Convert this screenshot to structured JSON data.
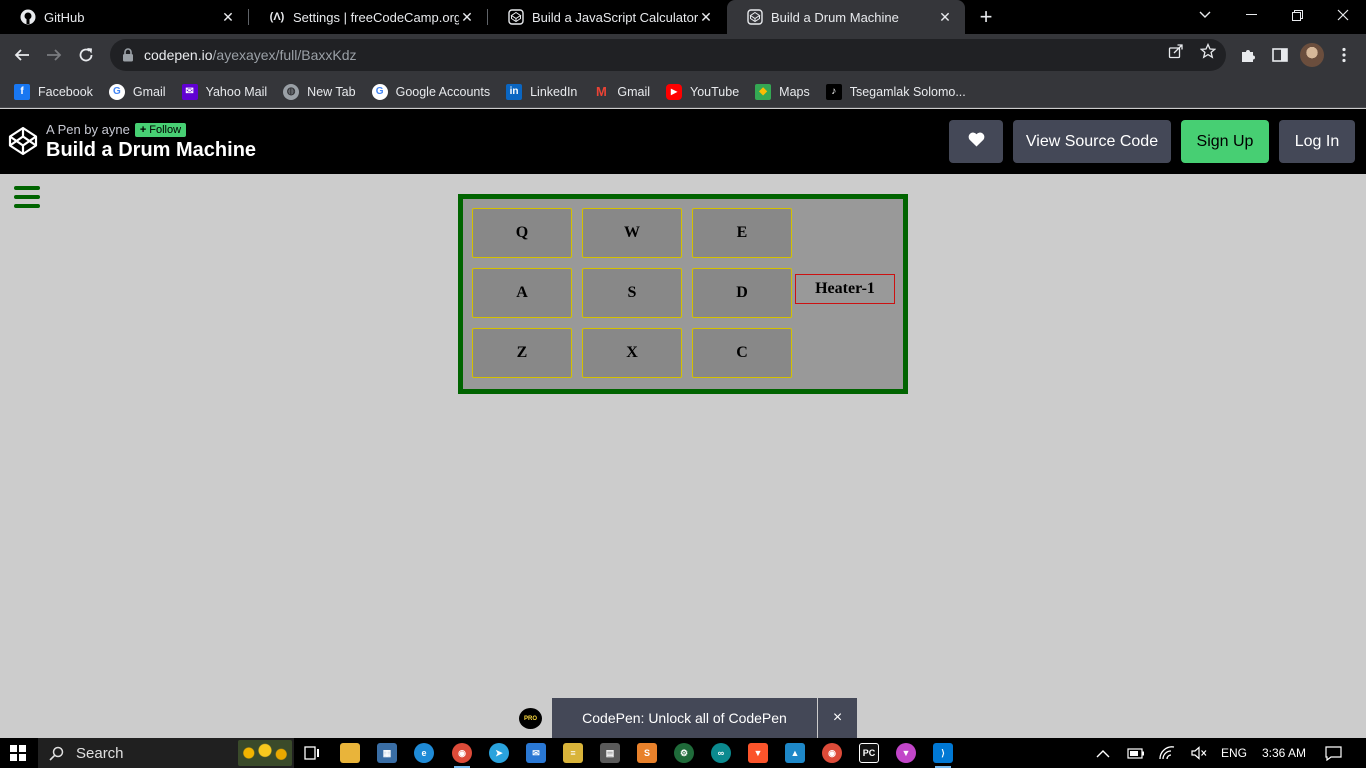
{
  "browser": {
    "tabs": [
      {
        "title": "GitHub",
        "icon": "github-icon",
        "active": false
      },
      {
        "title": "Settings | freeCodeCamp.org",
        "icon": "freecodecamp-icon",
        "active": false
      },
      {
        "title": "Build a JavaScript Calculator",
        "icon": "codepen-icon",
        "active": false
      },
      {
        "title": "Build a Drum Machine",
        "icon": "codepen-icon",
        "active": true
      }
    ],
    "url_host": "codepen.io",
    "url_path": "/ayexayex/full/BaxxKdz",
    "bookmarks": [
      {
        "label": "Facebook",
        "icon": "facebook-icon",
        "color": "#1877f2"
      },
      {
        "label": "Gmail",
        "icon": "google-icon",
        "color": "#ffffff"
      },
      {
        "label": "Yahoo Mail",
        "icon": "yahoo-mail-icon",
        "color": "#6001d2"
      },
      {
        "label": "New Tab",
        "icon": "globe-icon",
        "color": "#9aa0a6"
      },
      {
        "label": "Google Accounts",
        "icon": "google-icon",
        "color": "#ffffff"
      },
      {
        "label": "LinkedIn",
        "icon": "linkedin-icon",
        "color": "#0a66c2"
      },
      {
        "label": "Gmail",
        "icon": "gmail-icon",
        "color": "#ea4335"
      },
      {
        "label": "YouTube",
        "icon": "youtube-icon",
        "color": "#ff0000"
      },
      {
        "label": "Maps",
        "icon": "maps-icon",
        "color": "#34a853"
      },
      {
        "label": "Tsegamlak Solomo...",
        "icon": "tiktok-icon",
        "color": "#000000"
      }
    ]
  },
  "codepen": {
    "byline": "A Pen by ayne",
    "follow_label": "Follow",
    "pen_title": "Build a Drum Machine",
    "view_source_label": "View Source Code",
    "signup_label": "Sign Up",
    "login_label": "Log In"
  },
  "drum_machine": {
    "pads": [
      "Q",
      "W",
      "E",
      "A",
      "S",
      "D",
      "Z",
      "X",
      "C"
    ],
    "display": "Heater-1",
    "colors": {
      "border": "#006400",
      "background": "#999999",
      "pad": "#888888",
      "pad_border": "#d4c000",
      "display_border": "#cc1111"
    }
  },
  "promo": {
    "badge": "PRO",
    "text": "CodePen: Unlock all of CodePen",
    "close": "×"
  },
  "taskbar": {
    "search_placeholder": "Search",
    "language": "ENG",
    "time": "3:36 AM"
  }
}
